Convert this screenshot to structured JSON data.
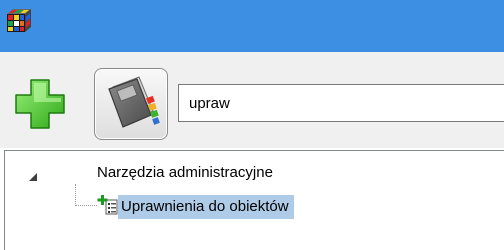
{
  "titlebar": {
    "app_icon": "colorful-cube-app-icon",
    "color": "#3c8fe3"
  },
  "toolbar": {
    "add_icon": "green-plus-icon",
    "book_icon": "address-book-icon",
    "search": {
      "value": "upraw"
    }
  },
  "tree": {
    "root": {
      "label": "Narzędzia administracyjne",
      "expander_icon": "collapse-triangle-icon",
      "expanded": true,
      "children": [
        {
          "label": "Uprawnienia do obiektów",
          "icon": "add-permission-list-icon",
          "selected": true
        }
      ]
    },
    "selection_color": "#aecce8"
  }
}
